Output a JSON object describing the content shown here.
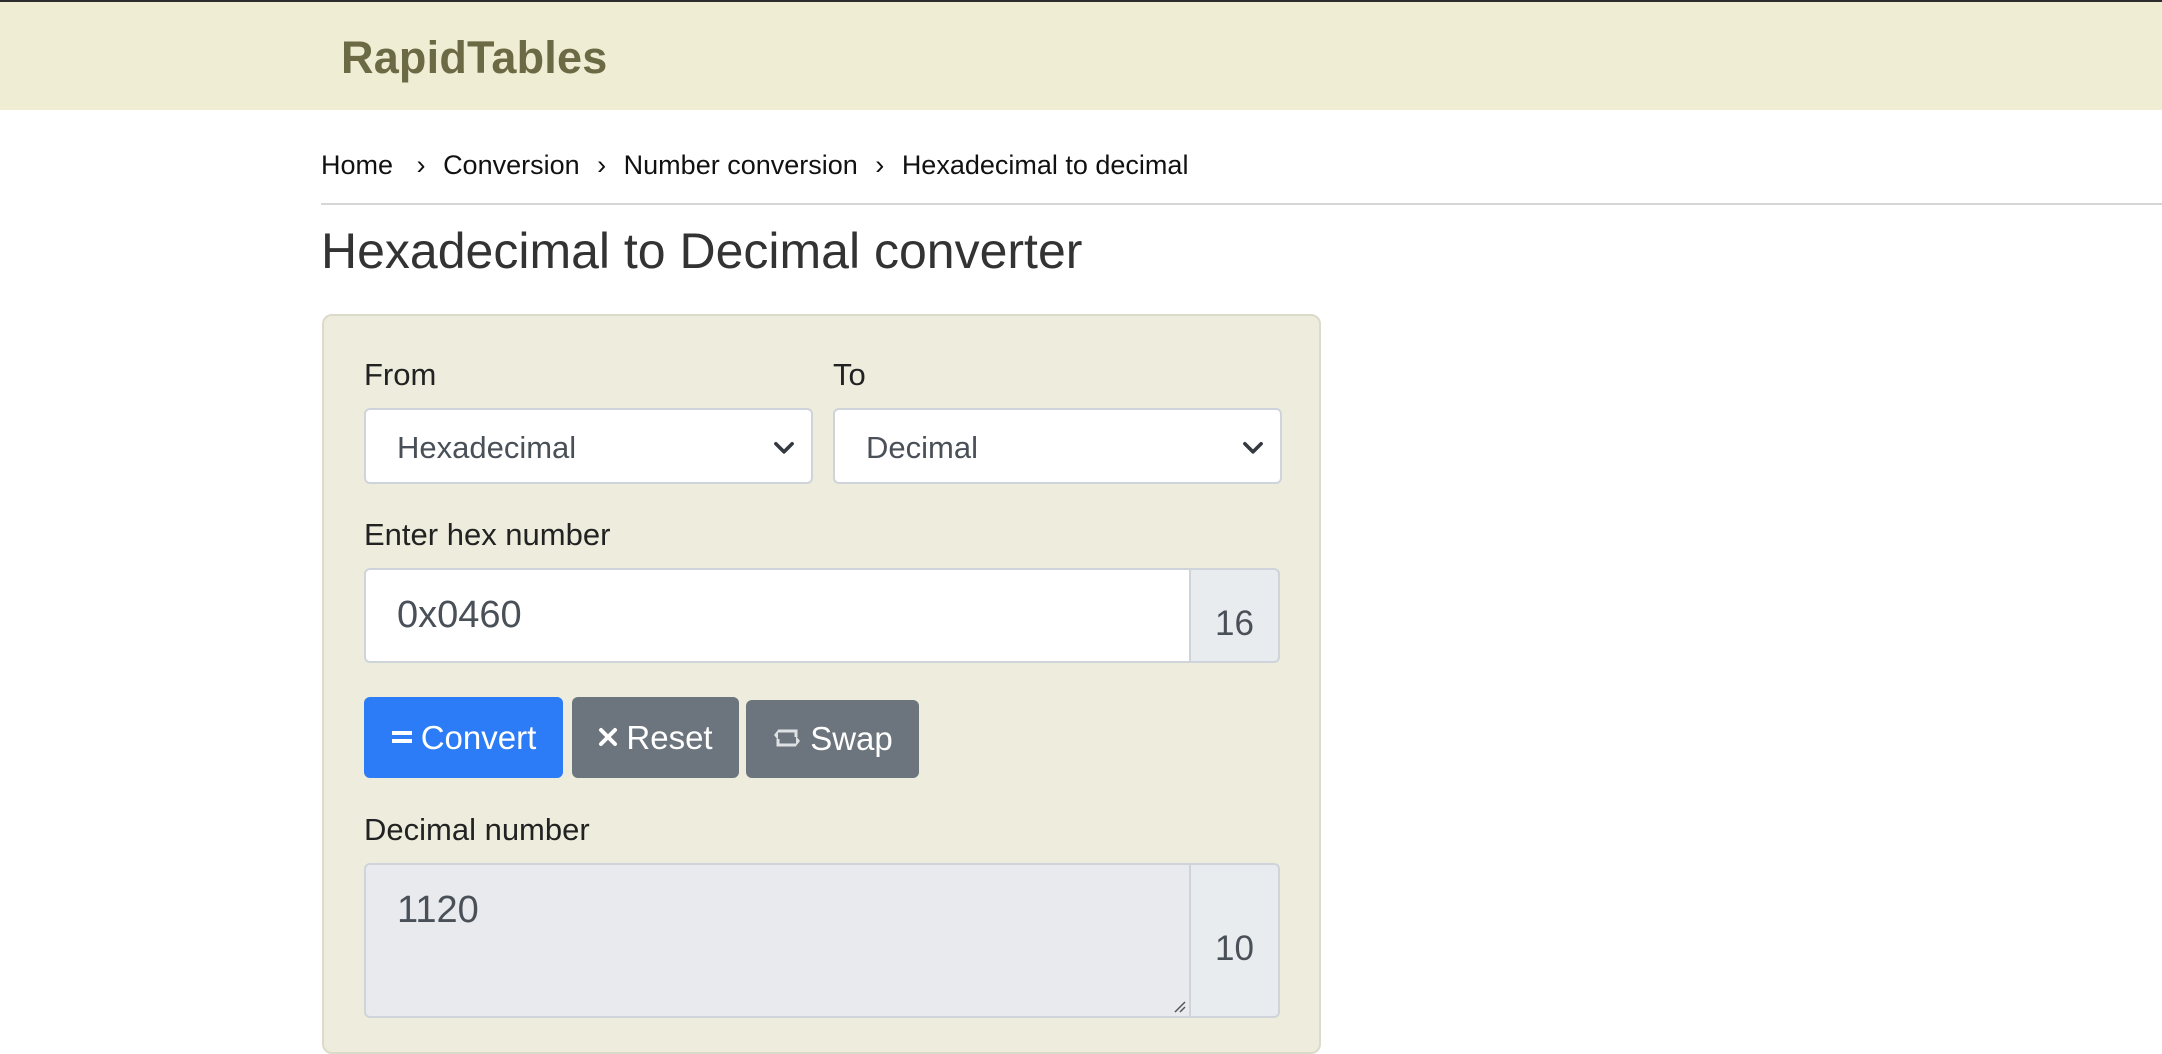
{
  "header": {
    "logo_text": "RapidTables"
  },
  "breadcrumb": {
    "items": [
      "Home",
      "Conversion",
      "Number conversion",
      "Hexadecimal to decimal"
    ],
    "separator": "›"
  },
  "page": {
    "title": "Hexadecimal to Decimal converter"
  },
  "converter": {
    "from_label": "From",
    "from_value": "Hexadecimal",
    "to_label": "To",
    "to_value": "Decimal",
    "input_label": "Enter hex number",
    "input_value": "0x0460",
    "input_base": "16",
    "buttons": {
      "convert_label": "Convert",
      "reset_label": "Reset",
      "swap_label": "Swap"
    },
    "output_label": "Decimal number",
    "output_value": "1120",
    "output_base": "10"
  },
  "colors": {
    "header_bg": "#efeed4",
    "logo": "#6b6a45",
    "panel_bg": "#eeecdc",
    "primary": "#2b7cf6",
    "secondary": "#6c757d"
  },
  "icons": {
    "convert": "equals-icon",
    "reset": "close-icon",
    "swap": "swap-icon",
    "select_arrow": "chevron-down-icon"
  }
}
